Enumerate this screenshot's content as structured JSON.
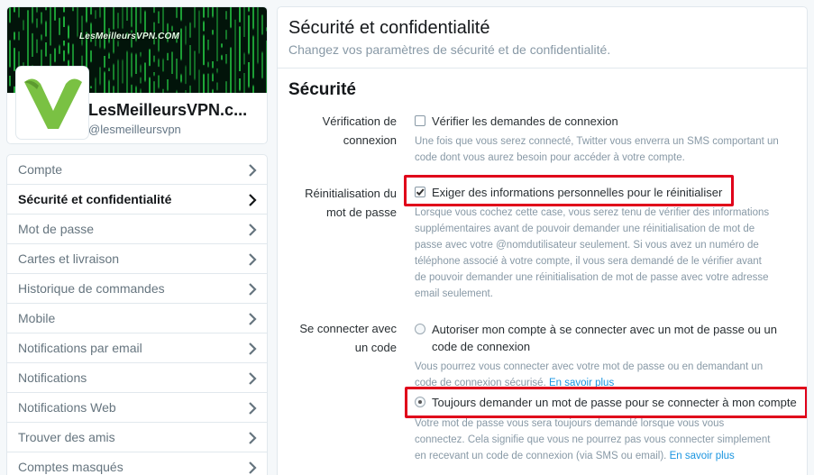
{
  "profile": {
    "banner_text": "LesMeilleursVPN.COM",
    "name": "LesMeilleursVPN.c...",
    "handle": "@lesmeilleursvpn",
    "colors": {
      "banner_bg": "#02140a",
      "matrix_green": "#1fae3a",
      "logo_green": "#7ac143"
    }
  },
  "sidebar": {
    "items": [
      {
        "label": "Compte"
      },
      {
        "label": "Sécurité et confidentialité"
      },
      {
        "label": "Mot de passe"
      },
      {
        "label": "Cartes et livraison"
      },
      {
        "label": "Historique de commandes"
      },
      {
        "label": "Mobile"
      },
      {
        "label": "Notifications par email"
      },
      {
        "label": "Notifications"
      },
      {
        "label": "Notifications Web"
      },
      {
        "label": "Trouver des amis"
      },
      {
        "label": "Comptes masqués"
      }
    ],
    "active_index": 1,
    "chevron_icon": "chevron-right-icon"
  },
  "main": {
    "title": "Sécurité et confidentialité",
    "subtitle": "Changez vos paramètres de sécurité et de confidentialité.",
    "section_title": "Sécurité",
    "login_verification": {
      "label_line1": "Vérification de",
      "label_line2": "connexion",
      "option": "Vérifier les demandes de connexion",
      "checked": false,
      "help_line1": "Une fois que vous serez connecté, Twitter vous enverra un SMS comportant un",
      "help_line2": "code dont vous aurez besoin pour accéder à votre compte."
    },
    "password_reset": {
      "label_line1": "Réinitialisation du",
      "label_line2": "mot de passe",
      "option": "Exiger des informations personnelles pour le réinitialiser",
      "checked": true,
      "help_lines": [
        "Lorsque vous cochez cette case, vous serez tenu de vérifier des informations",
        "supplémentaires avant de pouvoir demander une réinitialisation de mot de",
        "passe avec votre @nomdutilisateur seulement. Si vous avez un numéro de",
        "téléphone associé à votre compte, il vous sera demandé de le vérifier avant",
        "de pouvoir demander une réinitialisation de mot de passe avec votre adresse",
        "email seulement."
      ]
    },
    "login_with_code": {
      "label_line1": "Se connecter avec",
      "label_line2": "un code",
      "option1_line1": "Autoriser mon compte à se connecter avec un mot de passe ou un",
      "option1_line2": "code de connexion",
      "option1_selected": false,
      "help1_line1": "Vous pourrez vous connecter avec votre mot de passe ou en demandant un",
      "help1_line2": "code de connexion sécurisé.",
      "help1_link": "En savoir plus",
      "option2": "Toujours demander un mot de passe pour se connecter à mon compte",
      "option2_selected": true,
      "help2_line1": "Votre mot de passe vous sera toujours demandé lorsque vous vous",
      "help2_line2": "connectez. Cela signifie que vous ne pourrez pas vous connecter simplement",
      "help2_line3": "en recevant un code de connexion (via SMS ou email).",
      "help2_link": "En savoir plus"
    },
    "colors": {
      "highlight": "#e0001a",
      "link": "#1b95e0",
      "help_text": "#8899a6"
    }
  }
}
